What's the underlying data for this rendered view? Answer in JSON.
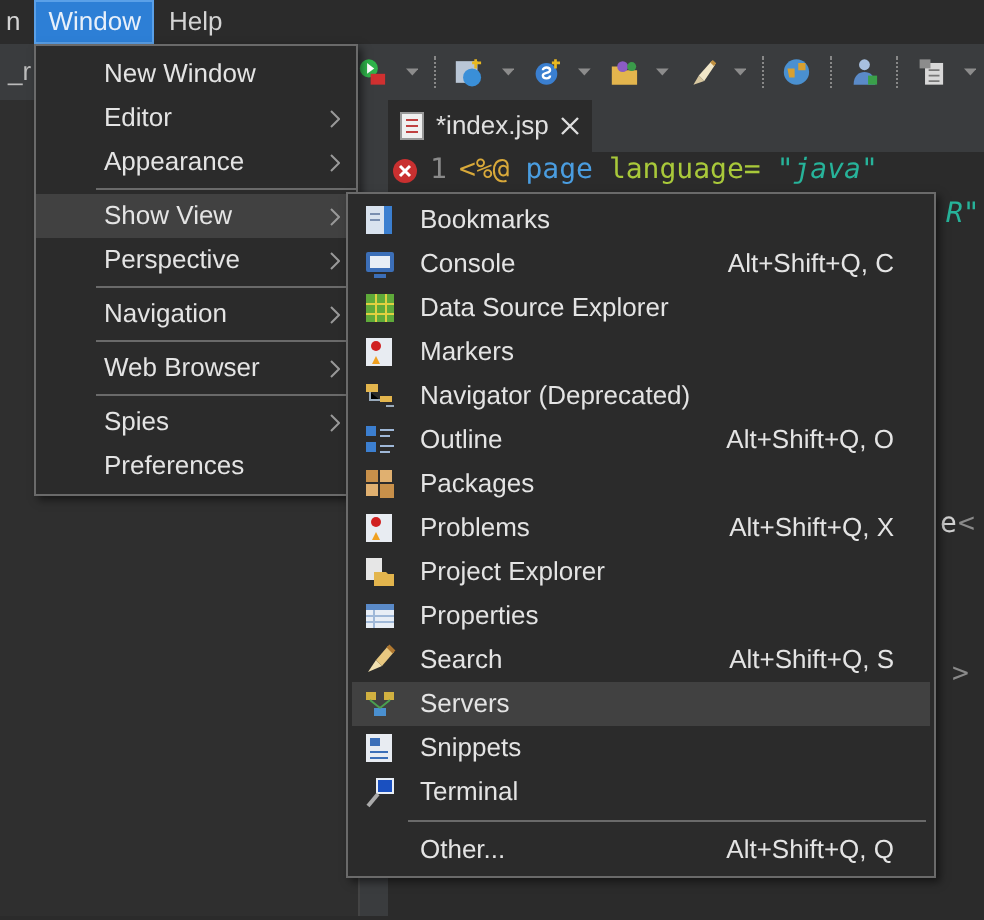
{
  "menubar": [
    {
      "label": "n",
      "selected": false
    },
    {
      "label": "Window",
      "selected": true
    },
    {
      "label": "Help",
      "selected": false
    }
  ],
  "toolbar": {
    "left_label": "_r"
  },
  "editor": {
    "tab": {
      "title": "*index.jsp",
      "selected": true
    },
    "line_number": "1",
    "line_1": [
      {
        "kind": "directive",
        "text": "<%@"
      },
      {
        "kind": "keyword",
        "text": "page"
      },
      {
        "kind": "attribute",
        "text": "language="
      },
      {
        "kind": "string",
        "text": "\"java\""
      }
    ],
    "fragments": [
      {
        "kind": "string",
        "text": "R\""
      },
      {
        "kind": "plain",
        "text": "e"
      },
      {
        "kind": "punct",
        "text": "<"
      },
      {
        "kind": "punct",
        "text": ">"
      }
    ]
  },
  "window_menu": [
    {
      "kind": "item",
      "label": "New Window",
      "submenu": false,
      "selected": false
    },
    {
      "kind": "item",
      "label": "Editor",
      "submenu": true,
      "selected": false
    },
    {
      "kind": "item",
      "label": "Appearance",
      "submenu": true,
      "selected": false
    },
    {
      "kind": "separator"
    },
    {
      "kind": "item",
      "label": "Show View",
      "submenu": true,
      "selected": true
    },
    {
      "kind": "item",
      "label": "Perspective",
      "submenu": true,
      "selected": false
    },
    {
      "kind": "separator"
    },
    {
      "kind": "item",
      "label": "Navigation",
      "submenu": true,
      "selected": false
    },
    {
      "kind": "separator"
    },
    {
      "kind": "item",
      "label": "Web Browser",
      "submenu": true,
      "selected": false
    },
    {
      "kind": "separator"
    },
    {
      "kind": "item",
      "label": "Spies",
      "submenu": true,
      "selected": false
    },
    {
      "kind": "item",
      "label": "Preferences",
      "submenu": false,
      "selected": false
    }
  ],
  "show_view_menu": [
    {
      "kind": "item",
      "label": "Bookmarks",
      "selected": false
    },
    {
      "kind": "item",
      "label": "Console",
      "shortcut": "Alt+Shift+Q, C",
      "selected": false
    },
    {
      "kind": "item",
      "label": "Data Source Explorer",
      "selected": false
    },
    {
      "kind": "item",
      "label": "Markers",
      "selected": false
    },
    {
      "kind": "item",
      "label": "Navigator (Deprecated)",
      "selected": false
    },
    {
      "kind": "item",
      "label": "Outline",
      "shortcut": "Alt+Shift+Q, O",
      "selected": false
    },
    {
      "kind": "item",
      "label": "Packages",
      "selected": false
    },
    {
      "kind": "item",
      "label": "Problems",
      "shortcut": "Alt+Shift+Q, X",
      "selected": false
    },
    {
      "kind": "item",
      "label": "Project Explorer",
      "selected": false
    },
    {
      "kind": "item",
      "label": "Properties",
      "selected": false
    },
    {
      "kind": "item",
      "label": "Search",
      "shortcut": "Alt+Shift+Q, S",
      "selected": false
    },
    {
      "kind": "item",
      "label": "Servers",
      "selected": true
    },
    {
      "kind": "item",
      "label": "Snippets",
      "selected": false
    },
    {
      "kind": "item",
      "label": "Terminal",
      "selected": false
    },
    {
      "kind": "separator"
    },
    {
      "kind": "item",
      "label": "Other...",
      "shortcut": "Alt+Shift+Q, Q",
      "selected": false
    }
  ]
}
